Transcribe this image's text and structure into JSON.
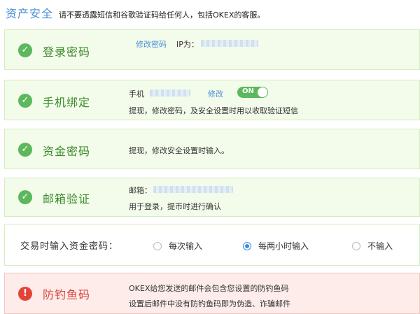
{
  "header": {
    "title": "资产安全",
    "warning": "请不要透露短信和谷歌验证码给任何人，包括OKEX的客服。"
  },
  "login": {
    "label": "登录密码",
    "change_link": "修改密码",
    "ip_label": "IP为："
  },
  "phone": {
    "label": "手机绑定",
    "phone_label": "手机",
    "edit_link": "修改",
    "toggle_label": "ON",
    "desc": "提现，修改密码，及安全设置时用以收取验证短信"
  },
  "fund": {
    "label": "资金密码",
    "desc": "提现，修改安全设置时输入。"
  },
  "email": {
    "label": "邮箱验证",
    "email_label": "邮箱：",
    "desc": "用于登录，提币时进行确认"
  },
  "trade": {
    "label": "交易时输入资金密码：",
    "options": [
      {
        "label": "每次输入",
        "selected": false
      },
      {
        "label": "每两小时输入",
        "selected": true
      },
      {
        "label": "不输入",
        "selected": false
      }
    ]
  },
  "anti_phishing": {
    "label": "防钓鱼码",
    "line1": "OKEX给您发送的邮件会包含您设置的防钓鱼码",
    "line2": "设置后邮件中没有防钓鱼码即为伪造、诈骗邮件"
  },
  "colors": {
    "accent_blue": "#4a90d9",
    "success_green": "#5cb85c",
    "danger_red": "#e2443a"
  },
  "icons": {
    "verified": "check-circle-icon",
    "warning": "exclamation-circle-icon"
  }
}
